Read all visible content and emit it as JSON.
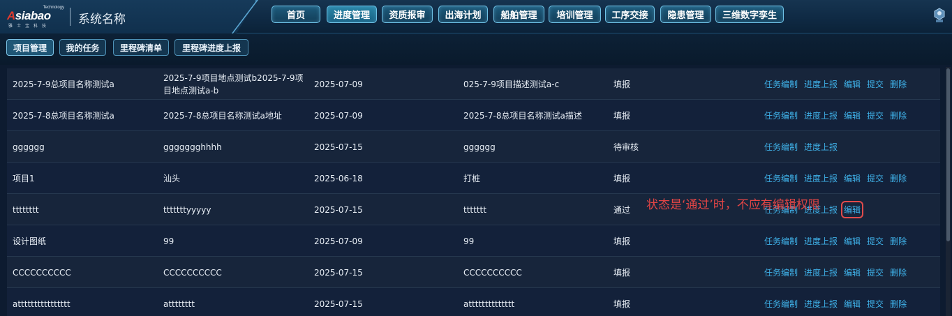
{
  "header": {
    "logo": {
      "brand": "Asiabao",
      "tagline": "Technology",
      "cn": "雅士宝科技"
    },
    "system_name": "系统名称",
    "nav": [
      "首页",
      "进度管理",
      "资质报审",
      "出海计划",
      "船舶管理",
      "培训管理",
      "工序交接",
      "隐患管理",
      "三维数字孪生"
    ],
    "active_nav": "进度管理",
    "user_icon": "user-icon"
  },
  "subtabs": [
    "项目管理",
    "我的任务",
    "里程碑清单",
    "里程碑进度上报"
  ],
  "active_subtab": "项目管理",
  "table": {
    "rows": [
      {
        "c1": "2025-7-9总项目名称测试a",
        "c2": "2025-7-9项目地点测试b2025-7-9项目地点测试a-b",
        "c3": "2025-07-09",
        "c4": "025-7-9项目描述测试a-c",
        "c5": "填报",
        "actions": [
          "任务编制",
          "进度上报",
          "编辑",
          "提交",
          "删除"
        ]
      },
      {
        "c1": "2025-7-8总项目名称测试a",
        "c2": "2025-7-8总项目名称测试a地址",
        "c3": "2025-07-09",
        "c4": "2025-7-8总项目名称测试a描述",
        "c5": "填报",
        "actions": [
          "任务编制",
          "进度上报",
          "编辑",
          "提交",
          "删除"
        ]
      },
      {
        "c1": "gggggg",
        "c2": "ggggggghhhh",
        "c3": "2025-07-15",
        "c4": "gggggg",
        "c5": "待审核",
        "actions": [
          "任务编制",
          "进度上报"
        ]
      },
      {
        "c1": "项目1",
        "c2": "汕头",
        "c3": "2025-06-18",
        "c4": "打桩",
        "c5": "填报",
        "actions": [
          "任务编制",
          "进度上报",
          "编辑",
          "提交",
          "删除"
        ]
      },
      {
        "c1": "tttttttt",
        "c2": "tttttttyyyyy",
        "c3": "2025-07-15",
        "c4": "ttttttt",
        "c5": "通过",
        "actions": [
          "任务编制",
          "进度上报",
          "编辑"
        ]
      },
      {
        "c1": "设计图纸",
        "c2": "99",
        "c3": "2025-07-09",
        "c4": "99",
        "c5": "填报",
        "actions": [
          "任务编制",
          "进度上报",
          "编辑",
          "提交",
          "删除"
        ]
      },
      {
        "c1": "CCCCCCCCCC",
        "c2": "CCCCCCCCCC",
        "c3": "2025-07-15",
        "c4": "CCCCCCCCCC",
        "c5": "填报",
        "actions": [
          "任务编制",
          "进度上报",
          "编辑",
          "提交",
          "删除"
        ]
      },
      {
        "c1": "atttttttttttttttt",
        "c2": "atttttttt",
        "c3": "2025-07-15",
        "c4": "atttttttttttttt",
        "c5": "填报",
        "actions": [
          "任务编制",
          "进度上报",
          "编辑",
          "提交",
          "删除"
        ]
      }
    ],
    "highlighted_action": {
      "row": 4,
      "label": "编辑"
    }
  },
  "annotation": "状态是‘通过’时，不应有编辑权限",
  "colors": {
    "link": "#3fb1e8",
    "annotation": "#e24545",
    "nav_border": "#6fc2e6",
    "row_even": "#17253b",
    "row_odd": "#13213a"
  }
}
